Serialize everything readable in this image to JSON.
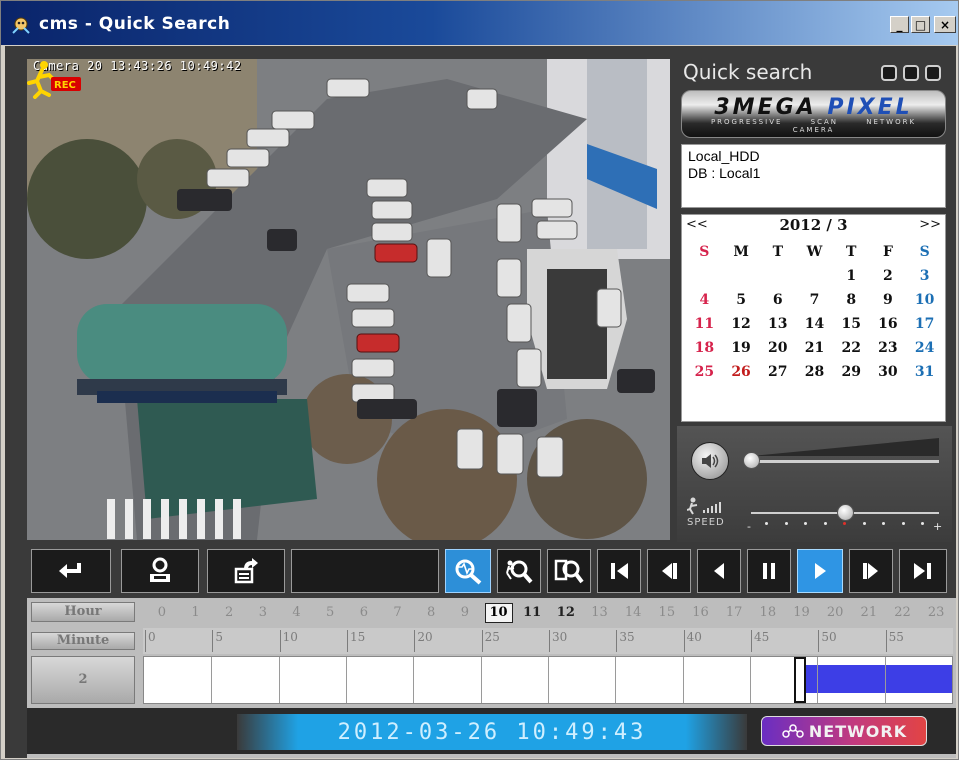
{
  "window": {
    "title": "cms - Quick Search",
    "minimize_label": "_",
    "maximize_label": "□",
    "close_label": "×"
  },
  "video": {
    "camera_overlay": "Camera 20 13:43:26 10:49:42",
    "rec_label": "REC"
  },
  "panel": {
    "title": "Quick search",
    "logo_main": "3MEGA",
    "logo_pixel": "PIXEL",
    "logo_sub_left": "PROGRESSIVE SCAN",
    "logo_sub_right": "NETWORK CAMERA",
    "db_line1": "Local_HDD",
    "db_line2": "DB : Local1"
  },
  "calendar": {
    "prev": "<<",
    "next": ">>",
    "title": "2012 / 3",
    "weekdays": [
      "S",
      "M",
      "T",
      "W",
      "T",
      "F",
      "S"
    ],
    "days": [
      "",
      "",
      "",
      "",
      "1",
      "2",
      "3",
      "4",
      "5",
      "6",
      "7",
      "8",
      "9",
      "10",
      "11",
      "12",
      "13",
      "14",
      "15",
      "16",
      "17",
      "18",
      "19",
      "20",
      "21",
      "22",
      "23",
      "24",
      "25",
      "26",
      "27",
      "28",
      "29",
      "30",
      "31"
    ],
    "selected_day": "26"
  },
  "audio": {
    "speed_label": "SPEED",
    "speed_minus": "-",
    "speed_plus": "+",
    "volume_level": 0.0,
    "speed_level": 0.5
  },
  "timeline": {
    "hour_label": "Hour",
    "minute_label": "Minute",
    "slot_label": "2",
    "hours": [
      "0",
      "1",
      "2",
      "3",
      "4",
      "5",
      "6",
      "7",
      "8",
      "9",
      "10",
      "11",
      "12",
      "13",
      "14",
      "15",
      "16",
      "17",
      "18",
      "19",
      "20",
      "21",
      "22",
      "23"
    ],
    "selected_hour": "10",
    "recorded_hours": [
      "10",
      "11",
      "12"
    ],
    "minute_ticks": [
      "0",
      "5",
      "10",
      "15",
      "20",
      "25",
      "30",
      "35",
      "40",
      "45",
      "50",
      "55"
    ],
    "recording_start_minute": 49,
    "recording_end_minute": 60
  },
  "status": {
    "datetime": "2012-03-26  10:49:43",
    "network_label": "NETWORK"
  },
  "colors": {
    "accent_blue": "#2d8fd8",
    "record_block": "#3d3ee6",
    "sunday": "#d6234c",
    "saturday": "#1c6fb4"
  }
}
